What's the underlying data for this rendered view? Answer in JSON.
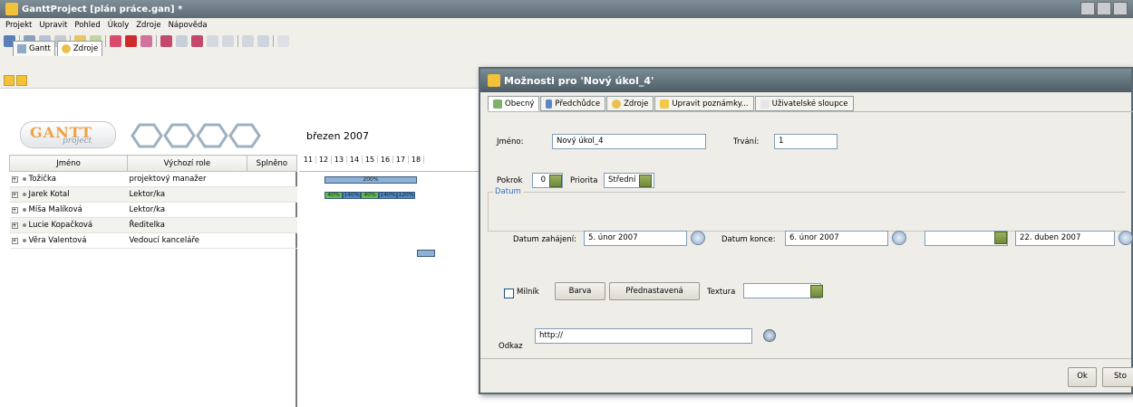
{
  "window": {
    "title": "GanttProject [plán práce.gan] *"
  },
  "menubar": [
    "Projekt",
    "Upravit",
    "Pohled",
    "Úkoly",
    "Zdroje",
    "Nápověda"
  ],
  "view_tabs": [
    {
      "label": "Gantt"
    },
    {
      "label": "Zdroje"
    }
  ],
  "resource_table": {
    "columns": [
      "Jméno",
      "Výchozí role",
      "Splněno"
    ],
    "rows": [
      {
        "name": "Tožička",
        "role": "projektový manažer",
        "done": ""
      },
      {
        "name": "Jarek Kotal",
        "role": "Lektor/ka",
        "done": ""
      },
      {
        "name": "Míša Malíková",
        "role": "Lektor/ka",
        "done": ""
      },
      {
        "name": "Lucie Kopačková",
        "role": "Ředitelka",
        "done": ""
      },
      {
        "name": "Věra Valentová",
        "role": "Vedoucí kanceláře",
        "done": ""
      }
    ]
  },
  "logo": {
    "line1": "GANTT",
    "line2": "project"
  },
  "chart": {
    "month": "březen 2007",
    "days": [
      "11",
      "12",
      "13",
      "14",
      "15",
      "16",
      "17",
      "18"
    ],
    "row1_load": "200%",
    "row2_loads": [
      "40%",
      "140%",
      "40%",
      "140%",
      "120%"
    ]
  },
  "dialog": {
    "title": "Možnosti pro 'Nový úkol_4'",
    "tabs": [
      "Obecný",
      "Předchůdce",
      "Zdroje",
      "Upravit poznámky...",
      "Uživatelské sloupce"
    ],
    "name_label": "Jméno:",
    "name_value": "Nový úkol_4",
    "duration_label": "Trvání:",
    "duration_value": "1",
    "progress_label": "Pokrok",
    "progress_value": "0",
    "priority_label": "Priorita",
    "priority_value": "Střední",
    "date_group": "Datum",
    "start_label": "Datum zahájení:",
    "start_value": "5. únor 2007",
    "end_label": "Datum konce:",
    "end_value": "6. únor 2007",
    "third_value": "",
    "fourth_value": "22. duben 2007",
    "milestone_label": "Milník",
    "color_button": "Barva",
    "default_button": "Přednastavená",
    "texture_label": "Textura",
    "texture_value": "",
    "link_label": "Odkaz",
    "link_value": "http://",
    "ok_button": "Ok",
    "storno_button": "Sto"
  }
}
